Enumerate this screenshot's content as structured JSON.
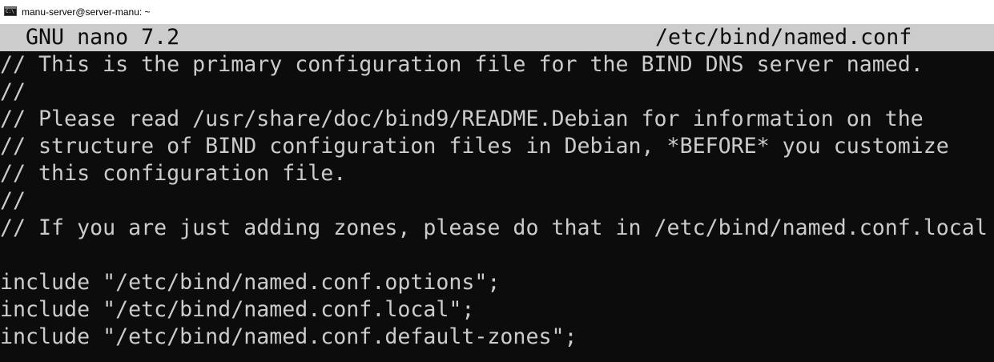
{
  "window": {
    "title": "manu-server@server-manu: ~",
    "icon": "command-prompt-icon"
  },
  "nano": {
    "app": "  GNU nano 7.2",
    "file": "/etc/bind/named.conf"
  },
  "lines": [
    "// This is the primary configuration file for the BIND DNS server named.",
    "//",
    "// Please read /usr/share/doc/bind9/README.Debian for information on the",
    "// structure of BIND configuration files in Debian, *BEFORE* you customize",
    "// this configuration file.",
    "//",
    "// If you are just adding zones, please do that in /etc/bind/named.conf.local",
    "",
    "include \"/etc/bind/named.conf.options\";",
    "include \"/etc/bind/named.conf.local\";",
    "include \"/etc/bind/named.conf.default-zones\";"
  ],
  "colors": {
    "terminal_bg": "#0c0c0c",
    "terminal_fg": "#cccccc",
    "header_bg": "#cccccc",
    "titlebar_bg": "#ffffff"
  }
}
